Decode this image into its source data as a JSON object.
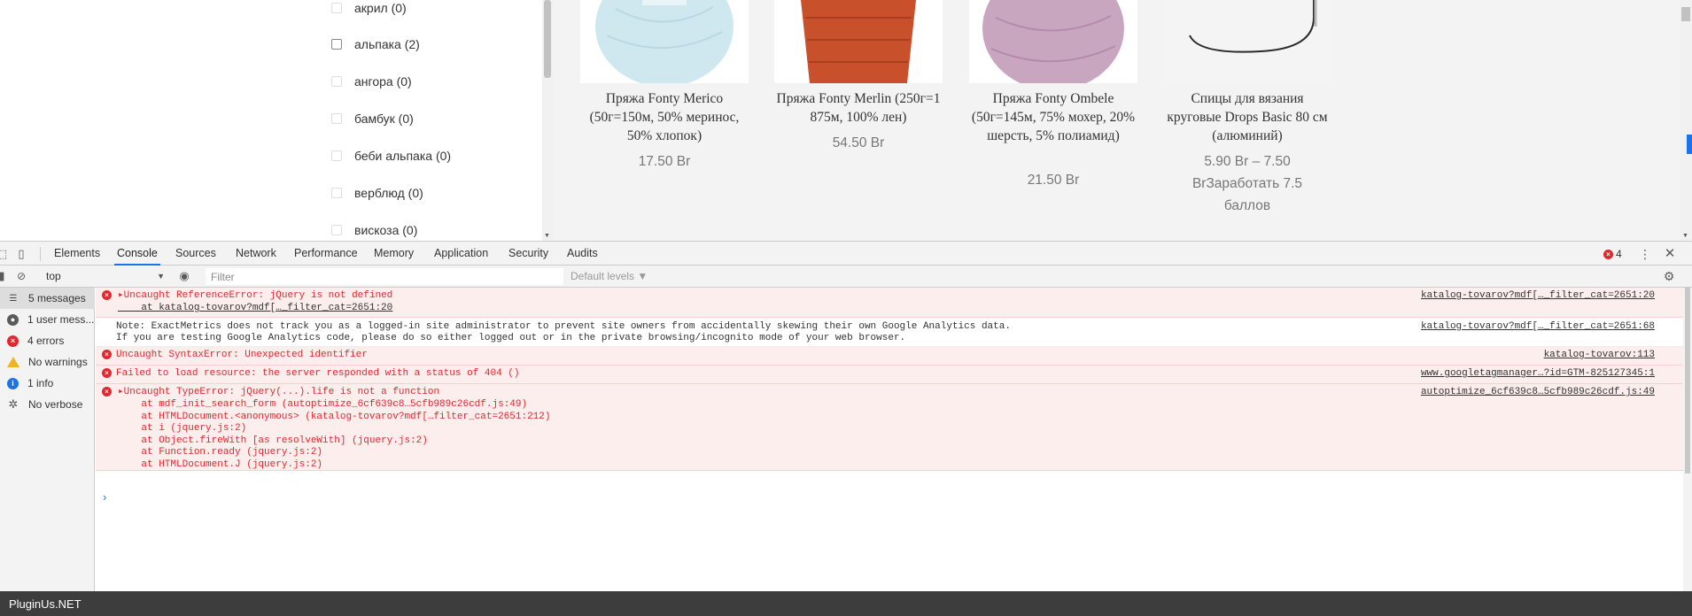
{
  "filters": {
    "items": [
      {
        "label": "акрил (0)",
        "state": "faded"
      },
      {
        "label": "альпака (2)",
        "state": "active"
      },
      {
        "label": "ангора (0)",
        "state": "faded"
      },
      {
        "label": "бамбук (0)",
        "state": "faded"
      },
      {
        "label": "беби альпака (0)",
        "state": "faded"
      },
      {
        "label": "верблюд (0)",
        "state": "faded"
      },
      {
        "label": "вискоза (0)",
        "state": "faded"
      }
    ]
  },
  "products": [
    {
      "name": "Пряжа Fonty Merico (50г=150м, 50% меринос, 50% хлопок)",
      "price": "17.50 Br",
      "photo_color": "#cfe8f0"
    },
    {
      "name": "Пряжа Fonty Merlin (250г=1 875м, 100% лен)",
      "price": "54.50 Br",
      "photo_color": "#c8502a"
    },
    {
      "name": "Пряжа Fonty Ombele (50г=145м, 75% мохер, 20% шерсть, 5% полиамид)",
      "price": "21.50 Br",
      "photo_color": "#c9a6c0"
    },
    {
      "name": "Спицы для вязания круговые Drops Basic 80 см (алюминий)",
      "price": "5.90 Br – 7.50 BrЗаработать 7.5 баллов",
      "photo_color": "#f4f4f4"
    }
  ],
  "devtools": {
    "tabs": [
      "Elements",
      "Console",
      "Sources",
      "Network",
      "Performance",
      "Memory",
      "Application",
      "Security",
      "Audits"
    ],
    "active_tab": "Console",
    "error_count": "4",
    "context": "top",
    "filter_placeholder": "Filter",
    "levels": "Default levels ▼",
    "sidebar": [
      {
        "label": "5 messages",
        "icon": "list-icon"
      },
      {
        "label": "1 user mess...",
        "icon": "user-icon"
      },
      {
        "label": "4 errors",
        "icon": "error-icon"
      },
      {
        "label": "No warnings",
        "icon": "warning-icon"
      },
      {
        "label": "1 info",
        "icon": "info-icon"
      },
      {
        "label": "No verbose",
        "icon": "verbose-icon"
      }
    ],
    "messages": [
      {
        "type": "error",
        "lines": [
          "▸Uncaught ReferenceError: jQuery is not defined",
          "    at katalog-tovarov?mdf[…_filter_cat=2651:20"
        ],
        "source": "katalog-tovarov?mdf[…_filter_cat=2651:20"
      },
      {
        "type": "note",
        "lines": [
          "Note: ExactMetrics does not track you as a logged-in site administrator to prevent site owners from accidentally skewing their own Google Analytics data.",
          "If you are testing Google Analytics code, please do so either logged out or in the private browsing/incognito mode of your web browser."
        ],
        "source": "katalog-tovarov?mdf[…_filter_cat=2651:68"
      },
      {
        "type": "error",
        "lines": [
          "Uncaught SyntaxError: Unexpected identifier"
        ],
        "source": "katalog-tovarov:113"
      },
      {
        "type": "error",
        "lines": [
          "Failed to load resource: the server responded with a status of 404 ()"
        ],
        "source": "www.googletagmanager…?id=GTM-825127345:1"
      },
      {
        "type": "error",
        "lines": [
          "▸Uncaught TypeError: jQuery(...).life is not a function",
          "    at mdf_init_search_form (autoptimize_6cf639c8…5cfb989c26cdf.js:49)",
          "    at HTMLDocument.<anonymous> (katalog-tovarov?mdf[…filter_cat=2651:212)",
          "    at i (jquery.js:2)",
          "    at Object.fireWith [as resolveWith] (jquery.js:2)",
          "    at Function.ready (jquery.js:2)",
          "    at HTMLDocument.J (jquery.js:2)"
        ],
        "source": "autoptimize_6cf639c8…5cfb989c26cdf.js:49"
      }
    ],
    "prompt": "›"
  },
  "taskbar": {
    "label": "PluginUs.NET"
  }
}
